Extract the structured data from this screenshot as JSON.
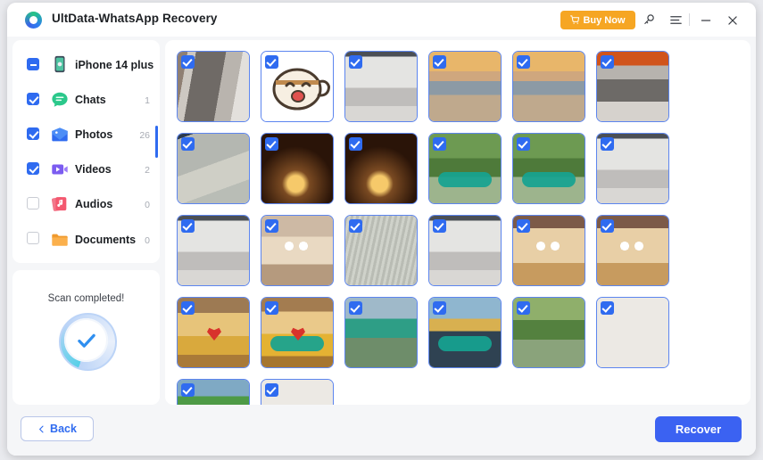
{
  "window": {
    "title": "UltData-WhatsApp Recovery",
    "logo_icon": "ultdata-circle-logo"
  },
  "titlebar": {
    "buy_now_label": "Buy Now",
    "buy_now_color": "#f6a623",
    "cart_icon": "shopping-cart-icon",
    "key_icon": "key-icon",
    "menu_icon": "hamburger-menu-icon",
    "minimize_icon": "minimize-icon",
    "close_icon": "close-icon"
  },
  "sidebar": {
    "items": [
      {
        "label": "iPhone 14 plus",
        "count": "",
        "state": "indeterminate",
        "icon": "phone-icon"
      },
      {
        "label": "Chats",
        "count": "1",
        "state": "checked",
        "icon": "chat-bubble-icon"
      },
      {
        "label": "Photos",
        "count": "26",
        "state": "checked",
        "icon": "photo-icon"
      },
      {
        "label": "Videos",
        "count": "2",
        "state": "checked",
        "icon": "video-icon"
      },
      {
        "label": "Audios",
        "count": "0",
        "state": "unchecked",
        "icon": "audio-note-icon"
      },
      {
        "label": "Documents",
        "count": "0",
        "state": "unchecked",
        "icon": "folder-icon"
      }
    ],
    "scrollbar_color": "#2f6bf0"
  },
  "scan": {
    "status_text": "Scan completed!",
    "check_icon": "checkmark-icon",
    "accent_color": "#2f8ff0"
  },
  "grid": {
    "selected_checkbox_color": "#2f6bf0",
    "border_color": "#5c85ef",
    "thumbnails": [
      {
        "id": 1,
        "selected": true,
        "kind": "photo-metal-fabric"
      },
      {
        "id": 2,
        "selected": true,
        "kind": "sticker-coffee-cup-smiling"
      },
      {
        "id": 3,
        "selected": true,
        "kind": "photo-gray-blank"
      },
      {
        "id": 4,
        "selected": true,
        "kind": "photo-beach-sunset"
      },
      {
        "id": 5,
        "selected": true,
        "kind": "photo-beach-sunset"
      },
      {
        "id": 6,
        "selected": true,
        "kind": "photo-turntable"
      },
      {
        "id": 7,
        "selected": true,
        "kind": "photo-gray-blur"
      },
      {
        "id": 8,
        "selected": true,
        "kind": "photo-candles"
      },
      {
        "id": 9,
        "selected": true,
        "kind": "photo-candles"
      },
      {
        "id": 10,
        "selected": true,
        "kind": "photo-green-nature-caption"
      },
      {
        "id": 11,
        "selected": true,
        "kind": "photo-green-nature-caption"
      },
      {
        "id": 12,
        "selected": true,
        "kind": "photo-gray-blank"
      },
      {
        "id": 13,
        "selected": true,
        "kind": "photo-gray-blank"
      },
      {
        "id": 14,
        "selected": true,
        "kind": "photo-pastry-eyes"
      },
      {
        "id": 15,
        "selected": true,
        "kind": "photo-texture-gray"
      },
      {
        "id": 16,
        "selected": true,
        "kind": "photo-gray-blank"
      },
      {
        "id": 17,
        "selected": true,
        "kind": "photo-pancake-face"
      },
      {
        "id": 18,
        "selected": true,
        "kind": "photo-pancake-face"
      },
      {
        "id": 19,
        "selected": true,
        "kind": "photo-latte-heart"
      },
      {
        "id": 20,
        "selected": true,
        "kind": "photo-latte-heart-caption"
      },
      {
        "id": 21,
        "selected": true,
        "kind": "photo-outdoor-green"
      },
      {
        "id": 22,
        "selected": true,
        "kind": "photo-sunglasses-caption"
      },
      {
        "id": 23,
        "selected": true,
        "kind": "photo-green-blur"
      },
      {
        "id": 24,
        "selected": true,
        "kind": "photo-blank"
      },
      {
        "id": 25,
        "selected": true,
        "kind": "photo-parrot-caption"
      },
      {
        "id": 26,
        "selected": true,
        "kind": "photo-blank"
      }
    ]
  },
  "footer": {
    "back_label": "Back",
    "back_icon": "chevron-left-icon",
    "recover_label": "Recover",
    "recover_color": "#3b62f2"
  }
}
